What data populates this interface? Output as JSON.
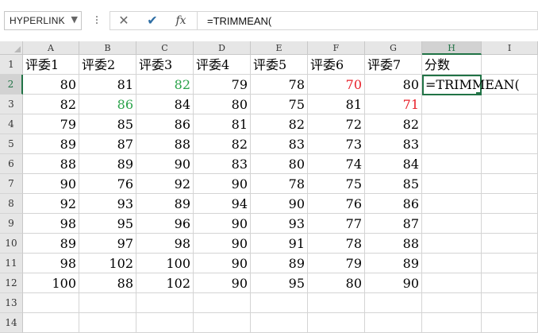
{
  "formula_bar": {
    "name_box": "HYPERLINK",
    "cancel_icon": "close-icon",
    "enter_icon": "check-icon",
    "fx_label": "fx",
    "formula": "=TRIMMEAN("
  },
  "columns": [
    "A",
    "B",
    "C",
    "D",
    "E",
    "F",
    "G",
    "H",
    "I"
  ],
  "rows": [
    {
      "num": "1",
      "cells": [
        "评委1",
        "评委2",
        "评委3",
        "评委4",
        "评委5",
        "评委6",
        "评委7",
        "分数",
        ""
      ]
    },
    {
      "num": "2",
      "cells": [
        "80",
        "81",
        "82",
        "79",
        "78",
        "70",
        "80",
        "",
        ""
      ]
    },
    {
      "num": "3",
      "cells": [
        "82",
        "86",
        "84",
        "80",
        "75",
        "81",
        "71",
        "",
        ""
      ]
    },
    {
      "num": "4",
      "cells": [
        "79",
        "85",
        "86",
        "81",
        "82",
        "72",
        "82",
        "",
        ""
      ]
    },
    {
      "num": "5",
      "cells": [
        "89",
        "87",
        "88",
        "82",
        "83",
        "73",
        "83",
        "",
        ""
      ]
    },
    {
      "num": "6",
      "cells": [
        "88",
        "89",
        "90",
        "83",
        "80",
        "74",
        "84",
        "",
        ""
      ]
    },
    {
      "num": "7",
      "cells": [
        "90",
        "76",
        "92",
        "90",
        "78",
        "75",
        "85",
        "",
        ""
      ]
    },
    {
      "num": "8",
      "cells": [
        "92",
        "93",
        "89",
        "94",
        "90",
        "76",
        "86",
        "",
        ""
      ]
    },
    {
      "num": "9",
      "cells": [
        "98",
        "95",
        "96",
        "90",
        "93",
        "77",
        "87",
        "",
        ""
      ]
    },
    {
      "num": "10",
      "cells": [
        "89",
        "97",
        "98",
        "90",
        "91",
        "78",
        "88",
        "",
        ""
      ]
    },
    {
      "num": "11",
      "cells": [
        "98",
        "102",
        "100",
        "90",
        "89",
        "79",
        "89",
        "",
        ""
      ]
    },
    {
      "num": "12",
      "cells": [
        "100",
        "88",
        "102",
        "90",
        "95",
        "80",
        "90",
        "",
        ""
      ]
    },
    {
      "num": "13",
      "cells": [
        "",
        "",
        "",
        "",
        "",
        "",
        "",
        "",
        ""
      ]
    },
    {
      "num": "14",
      "cells": [
        "",
        "",
        "",
        "",
        "",
        "",
        "",
        "",
        ""
      ]
    }
  ],
  "active_cell": {
    "ref": "H2",
    "text": "=TRIMMEAN("
  },
  "highlight_colors": {
    "red": "#e8202a",
    "green": "#2aa34a",
    "accent": "#217346"
  },
  "colored_cells": {
    "red": [
      "F2",
      "G3"
    ],
    "green": [
      "C2",
      "B3"
    ]
  }
}
